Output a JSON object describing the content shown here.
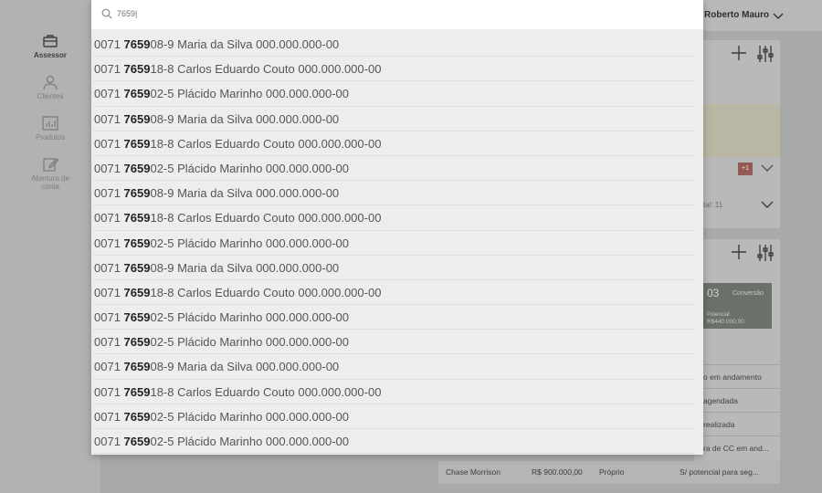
{
  "sidebar": {
    "items": [
      {
        "label": "Assessor",
        "icon": "briefcase-icon"
      },
      {
        "label": "Clientes",
        "icon": "person-icon"
      },
      {
        "label": "Produtos",
        "icon": "bar-chart-icon"
      },
      {
        "label": "Abertura de conta",
        "icon": "edit-icon"
      }
    ]
  },
  "header": {
    "user_name": "Roberto Mauro"
  },
  "panel_a": {
    "badge": "+1",
    "total_text": "tal: 11"
  },
  "panel_b": {
    "card_number": "03",
    "card_label": "Conversão",
    "card_potential_label": "Potencial",
    "card_potential_value": "R$440.000,00",
    "status_rows": [
      "o em andamento",
      "agendada",
      "realizada",
      "ra de CC em and..."
    ]
  },
  "bottom_row": {
    "name": "Chase Morrison",
    "value": "R$ 900.000,00",
    "type": "Próprio",
    "status": "S/ potencial para seg..."
  },
  "search": {
    "value": "7659|",
    "results": [
      {
        "pre": "0071 ",
        "match": "7659",
        "post": "08-9 Maria da Silva 000.000.000-00"
      },
      {
        "pre": "0071 ",
        "match": "7659",
        "post": "18-8 Carlos Eduardo Couto 000.000.000-00"
      },
      {
        "pre": "0071 ",
        "match": "7659",
        "post": "02-5 Plácido Marinho 000.000.000-00"
      },
      {
        "pre": "0071 ",
        "match": "7659",
        "post": "08-9 Maria da Silva 000.000.000-00"
      },
      {
        "pre": "0071 ",
        "match": "7659",
        "post": "18-8 Carlos Eduardo Couto 000.000.000-00"
      },
      {
        "pre": "0071 ",
        "match": "7659",
        "post": "02-5 Plácido Marinho 000.000.000-00"
      },
      {
        "pre": "0071 ",
        "match": "7659",
        "post": "08-9 Maria da Silva 000.000.000-00"
      },
      {
        "pre": "0071 ",
        "match": "7659",
        "post": "18-8 Carlos Eduardo Couto 000.000.000-00"
      },
      {
        "pre": "0071 ",
        "match": "7659",
        "post": "02-5 Plácido Marinho 000.000.000-00"
      },
      {
        "pre": "0071 ",
        "match": "7659",
        "post": "08-9 Maria da Silva 000.000.000-00"
      },
      {
        "pre": "0071 ",
        "match": "7659",
        "post": "18-8 Carlos Eduardo Couto 000.000.000-00"
      },
      {
        "pre": "0071 ",
        "match": "7659",
        "post": "02-5 Plácido Marinho 000.000.000-00"
      },
      {
        "pre": "0071 ",
        "match": "7659",
        "post": "02-5 Plácido Marinho 000.000.000-00"
      },
      {
        "pre": "0071 ",
        "match": "7659",
        "post": "08-9 Maria da Silva 000.000.000-00"
      },
      {
        "pre": "0071 ",
        "match": "7659",
        "post": "18-8 Carlos Eduardo Couto 000.000.000-00"
      },
      {
        "pre": "0071 ",
        "match": "7659",
        "post": "02-5 Plácido Marinho 000.000.000-00"
      },
      {
        "pre": "0071 ",
        "match": "7659",
        "post": "02-5 Plácido Marinho 000.000.000-00"
      }
    ]
  }
}
